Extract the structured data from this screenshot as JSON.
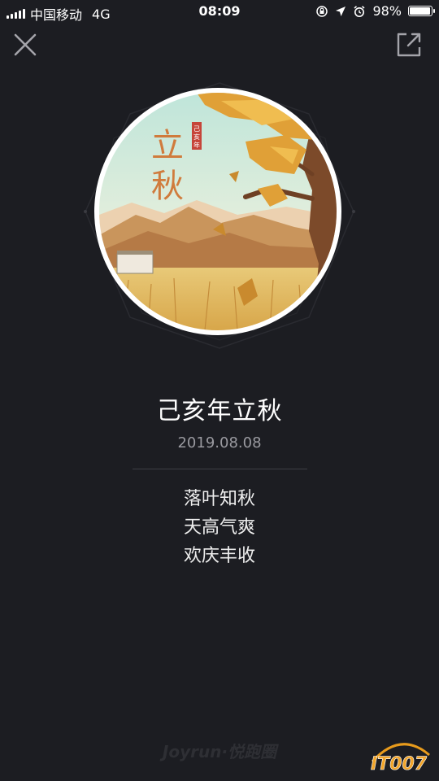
{
  "status_bar": {
    "carrier": "中国移动",
    "network": "4G",
    "time": "08:09",
    "battery_percent": "98%",
    "battery_level": 0.98
  },
  "header": {
    "close_icon": "close-icon",
    "share_icon": "share-icon"
  },
  "badge": {
    "art_title": "立秋",
    "art_stamp": "己亥年"
  },
  "main": {
    "title": "己亥年立秋",
    "date": "2019.08.08",
    "lines": [
      "落叶知秋",
      "天高气爽",
      "欢庆丰收"
    ]
  },
  "footer": {
    "brand": "Joyrun·悦跑圈",
    "watermark": "IT007"
  },
  "colors": {
    "background": "#1c1d22",
    "accent_gold": "#e5a93a",
    "sky": "#cde9de"
  }
}
